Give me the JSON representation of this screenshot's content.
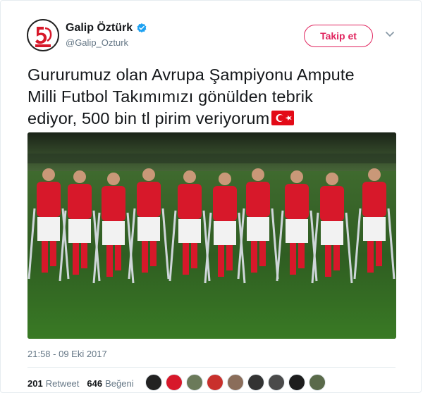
{
  "tweet": {
    "author_name": "Galip Öztürk",
    "author_handle": "@Galip_Ozturk",
    "avatar_icon": "logo-65-temmuz",
    "verified_icon": "verified-badge-icon",
    "follow_label": "Takip et",
    "menu_icon": "chevron-down-icon",
    "text_line1": "Gururumuz olan Avrupa Şampiyonu Ampute",
    "text_line2": "Milli Futbol Takımımızı gönülden tebrik",
    "text_line3": "ediyor, 500 bin tl pirim veriyorum",
    "flag_icon": "turkey-flag-icon",
    "timestamp": "21:58 - 09 Eki 2017",
    "retweet_count": "201",
    "retweet_label": "Retweet",
    "like_count": "646",
    "like_label": "Beğeni"
  },
  "colors": {
    "accent": "#e0245e",
    "verified": "#1da1f2",
    "muted": "#657786",
    "text": "#14171a",
    "jersey_red": "#d7182a"
  },
  "likers": [
    "liker-avatar-1",
    "liker-avatar-2",
    "liker-avatar-3",
    "liker-avatar-4",
    "liker-avatar-5",
    "liker-avatar-6",
    "liker-avatar-7",
    "liker-avatar-8",
    "liker-avatar-9"
  ]
}
